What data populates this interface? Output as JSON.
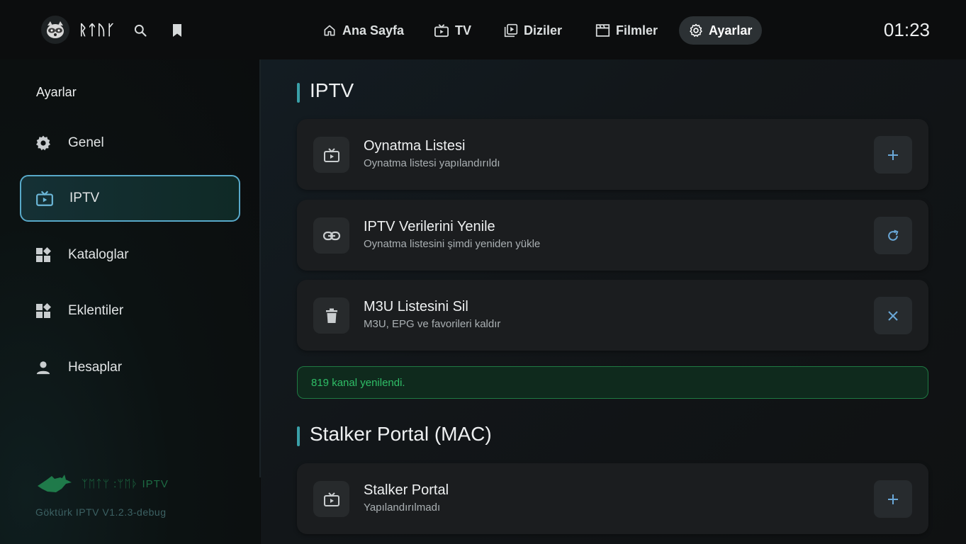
{
  "header": {
    "brand": "ᚱᛏᚢᚴ",
    "nav": [
      {
        "label": "Ana Sayfa",
        "icon": "home-icon"
      },
      {
        "label": "TV",
        "icon": "tv-icon"
      },
      {
        "label": "Diziler",
        "icon": "video-library-icon"
      },
      {
        "label": "Filmler",
        "icon": "movie-clapper-icon"
      },
      {
        "label": "Ayarlar",
        "icon": "gear-icon",
        "active": true
      }
    ],
    "clock": "01:23"
  },
  "sidebar": {
    "title": "Ayarlar",
    "items": [
      {
        "label": "Genel",
        "icon": "gear-icon"
      },
      {
        "label": "IPTV",
        "icon": "tv-icon",
        "active": true
      },
      {
        "label": "Kataloglar",
        "icon": "widgets-icon"
      },
      {
        "label": "Eklentiler",
        "icon": "widgets-icon"
      },
      {
        "label": "Hesaplar",
        "icon": "person-icon"
      }
    ],
    "footer_text": "ᛉᛖᛏᛘ :ᛘᛖᚦ IPTV",
    "version": "Göktürk IPTV V1.2.3-debug"
  },
  "main": {
    "iptv_title": "IPTV",
    "cards": [
      {
        "title": "Oynatma Listesi",
        "subtitle": "Oynatma listesi yapılandırıldı",
        "icon": "tv-icon",
        "action": "plus-icon"
      },
      {
        "title": "IPTV Verilerini Yenile",
        "subtitle": "Oynatma listesini şimdi yeniden yükle",
        "icon": "link-icon",
        "action": "refresh-icon"
      },
      {
        "title": "M3U Listesini Sil",
        "subtitle": "M3U, EPG ve favorileri kaldır",
        "icon": "trash-icon",
        "action": "close-icon"
      }
    ],
    "notice": "819 kanal yenilendi.",
    "stalker_title": "Stalker Portal (MAC)",
    "stalker_card": {
      "title": "Stalker Portal",
      "subtitle": "Yapılandırılmadı",
      "icon": "tv-icon",
      "action": "plus-icon"
    }
  },
  "colors": {
    "accent": "#3aa0a8",
    "active_border": "#58a9c9",
    "success": "#2fbe67",
    "action_icon": "#6aa8d8"
  }
}
